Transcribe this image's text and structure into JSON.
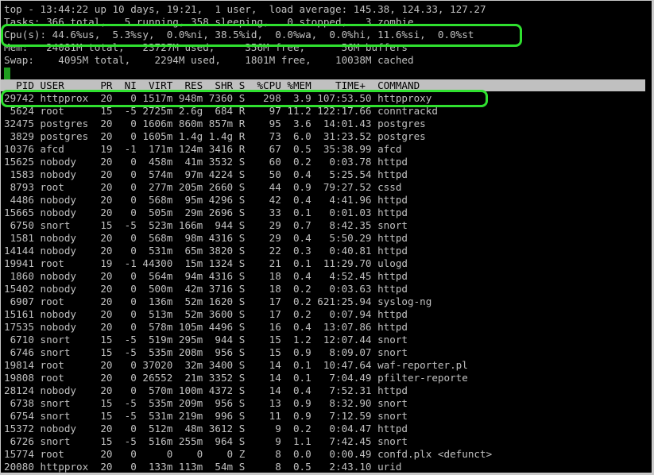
{
  "summary": {
    "top_line": "top - 13:44:22 up 10 days, 19:21,  1 user,  load average: 145.38, 124.33, 127.27",
    "tasks_line": "Tasks: 366 total,   5 running, 358 sleeping,   0 stopped,   3 zombie",
    "cpu_line": "Cpu(s): 44.6%us,  5.3%sy,  0.0%ni, 38.5%id,  0.0%wa,  0.0%hi, 11.6%si,  0.0%st",
    "mem_line": "Mem:   24081M total,   23727M used,     356M free,      56M buffers",
    "swap_line": "Swap:    4095M total,    2294M used,    1801M free,    10038M cached"
  },
  "columns_header": "  PID USER      PR  NI  VIRT  RES  SHR S  %CPU %MEM    TIME+  COMMAND",
  "processes": [
    "29742 httpprox  20   0 1517m 948m 7360 S   298  3.9 107:53.50 httpproxy",
    " 5624 root      15  -5 2725m 2.6g  684 R    97 11.2 122:17.66 conntrackd",
    "32475 postgres  20   0 1606m 860m 857m R    95  3.6  14:01.43 postgres",
    " 3829 postgres  20   0 1605m 1.4g 1.4g R    73  6.0  31:23.52 postgres",
    "10376 afcd      19  -1  171m 124m 3416 R    67  0.5  35:38.99 afcd",
    "15625 nobody    20   0  458m  41m 3532 S    60  0.2   0:03.78 httpd",
    " 1583 nobody    20   0  574m  97m 4224 S    50  0.4   5:25.54 httpd",
    " 8793 root      20   0  277m 205m 2660 S    44  0.9  79:27.52 cssd",
    " 4486 nobody    20   0  568m  95m 4296 S    42  0.4   4:41.96 httpd",
    "15665 nobody    20   0  505m  29m 2696 S    33  0.1   0:01.03 httpd",
    " 6750 snort     15  -5  523m 166m  944 S    29  0.7   8:42.35 snort",
    " 1581 nobody    20   0  568m  98m 4316 S    29  0.4   5:50.29 httpd",
    "14144 nobody    20   0  531m  65m 3820 S    22  0.3   0:40.81 httpd",
    "19941 root      19  -1 44300  15m 1324 S    21  0.1  11:29.70 ulogd",
    " 1860 nobody    20   0  564m  94m 4316 S    18  0.4   4:52.45 httpd",
    "15402 nobody    20   0  500m  42m 3716 S    18  0.2   0:03.63 httpd",
    " 6907 root      20   0  136m  52m 1620 S    17  0.2 621:25.94 syslog-ng",
    "15161 nobody    20   0  513m  52m 3600 S    17  0.2   0:07.94 httpd",
    "17535 nobody    20   0  578m 105m 4496 S    16  0.4  13:07.86 httpd",
    " 6710 snort     15  -5  519m 295m  944 S    15  1.2  12:07.44 snort",
    " 6746 snort     15  -5  535m 208m  956 S    15  0.9   8:09.07 snort",
    "19814 root      20   0 37020  32m 3400 S    14  0.1  10:47.64 waf-reporter.pl",
    "19808 root      20   0 26552  21m 3352 S    14  0.1   7:04.49 pfilter-reporte",
    "28124 nobody    20   0  570m 100m 4372 S    14  0.4   7:52.31 httpd",
    " 6738 snort     15  -5  535m 209m  956 S    13  0.9   8:32.90 snort",
    " 6754 snort     15  -5  531m 219m  996 S    11  0.9   7:12.59 snort",
    "15372 nobody    20   0  512m  48m 3612 S     9  0.2   0:04.47 httpd",
    " 6726 snort     15  -5  516m 255m  964 S     9  1.1   7:42.45 snort",
    "15774 root      20   0     0    0    0 Z     8  0.0   0:00.49 confd.plx <defunct>",
    "20080 httpprox  20   0  133m 113m  54m S     8  0.5   2:43.10 urid"
  ],
  "colors": {
    "terminal_bg": "#000000",
    "text": "#c0c0c0",
    "header_bar": "#c0c0c0",
    "highlight": "#2fe02f",
    "cursor": "#1f9d1f"
  }
}
